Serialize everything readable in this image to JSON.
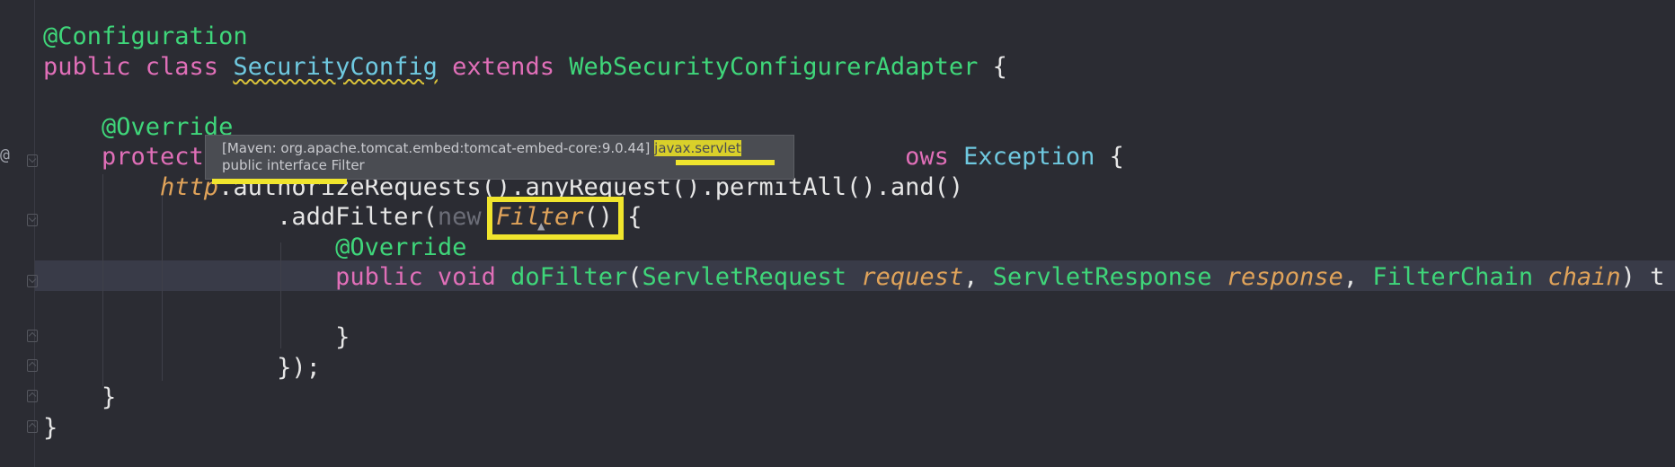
{
  "editor": {
    "override_marker": "@",
    "code_lines": [
      {
        "tokens": [
          {
            "t": "@Configuration",
            "c": "ann"
          }
        ]
      },
      {
        "tokens": [
          {
            "t": "public class ",
            "c": "kw"
          },
          {
            "t": "SecurityConfig",
            "c": "clsname squiggle"
          },
          {
            "t": " extends ",
            "c": "kw"
          },
          {
            "t": "WebSecurityConfigurerAdapter",
            "c": "type"
          },
          {
            "t": " {",
            "c": "call"
          }
        ]
      },
      {
        "tokens": []
      },
      {
        "tokens": [
          {
            "t": "    @Override",
            "c": "ann"
          }
        ]
      },
      {
        "tokens": [
          {
            "t": "    protect",
            "c": "kw"
          },
          {
            "t": "                                                ows ",
            "c": "kw"
          },
          {
            "t": "Exception",
            "c": "exc"
          },
          {
            "t": " {",
            "c": "call"
          }
        ]
      },
      {
        "tokens": [
          {
            "t": "        http",
            "c": "field"
          },
          {
            "t": ".authorizeRequests().anyRequest().permitAll().and()",
            "c": "call"
          }
        ]
      },
      {
        "tokens": [
          {
            "t": "                .addFilter(",
            "c": "call"
          },
          {
            "t": "new ",
            "c": "hint"
          },
          {
            "t": "Filter",
            "c": "field"
          },
          {
            "t": "() {",
            "c": "call"
          }
        ]
      },
      {
        "tokens": [
          {
            "t": "                    @Override",
            "c": "ann"
          }
        ]
      },
      {
        "tokens": [
          {
            "t": "                    public void ",
            "c": "kw"
          },
          {
            "t": "doFilter",
            "c": "type"
          },
          {
            "t": "(",
            "c": "call"
          },
          {
            "t": "ServletRequest",
            "c": "type"
          },
          {
            "t": " ",
            "c": "call"
          },
          {
            "t": "request",
            "c": "param"
          },
          {
            "t": ", ",
            "c": "call"
          },
          {
            "t": "ServletResponse",
            "c": "type"
          },
          {
            "t": " ",
            "c": "call"
          },
          {
            "t": "response",
            "c": "param"
          },
          {
            "t": ", ",
            "c": "call"
          },
          {
            "t": "FilterChain",
            "c": "type"
          },
          {
            "t": " ",
            "c": "call"
          },
          {
            "t": "chain",
            "c": "param"
          },
          {
            "t": ") t",
            "c": "call"
          }
        ]
      },
      {
        "tokens": []
      },
      {
        "tokens": [
          {
            "t": "                    }",
            "c": "call"
          }
        ]
      },
      {
        "tokens": [
          {
            "t": "                });",
            "c": "call"
          }
        ]
      },
      {
        "tokens": [
          {
            "t": "    }",
            "c": "call"
          }
        ]
      },
      {
        "tokens": [
          {
            "t": "}",
            "c": "call"
          }
        ]
      }
    ]
  },
  "tooltip": {
    "line1_prefix": "[Maven: org.apache.tomcat.embed:tomcat-embed-core:9.0.44] ",
    "line1_package": "javax.servlet",
    "line2": "public interface Filter"
  },
  "colors": {
    "background": "#2b2c33",
    "keyword": "#e06fb8",
    "annotation": "#3fd67a",
    "parameter": "#e0a35a",
    "highlight": "#f0e52d"
  }
}
